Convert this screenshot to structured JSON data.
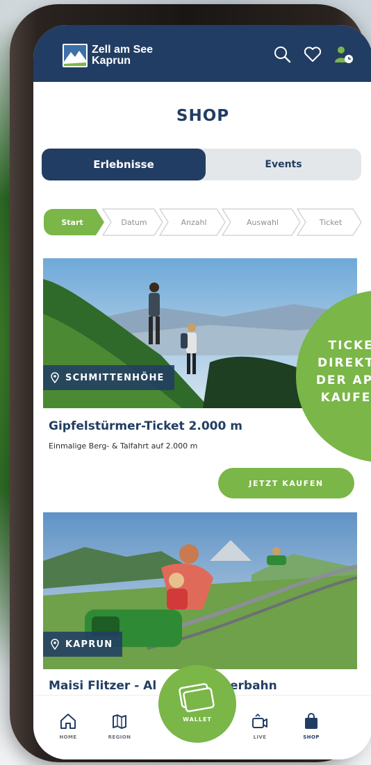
{
  "header": {
    "brand_line1": "Zell am See",
    "brand_line2": "Kaprun"
  },
  "page_title": "SHOP",
  "segments": {
    "left": "Erlebnisse",
    "right": "Events"
  },
  "steps": [
    "Start",
    "Datum",
    "Anzahl",
    "Auswahl",
    "Ticket"
  ],
  "cards": [
    {
      "location": "SCHMITTENHÖHE",
      "title": "Gipfelstürmer-Ticket 2.000 m",
      "subtitle": "Einmalige Berg- & Talfahrt auf 2.000 m",
      "button": "JETZT KAUFEN"
    },
    {
      "location": "KAPRUN",
      "title_left": "Maisi Flitzer - Al",
      "title_right": "erbahn"
    }
  ],
  "promo": {
    "line1": "TICKET",
    "line2": "DIREKT",
    "line3": "DER AP",
    "line4": "KAUFE"
  },
  "nav": {
    "home": "HOME",
    "region": "REGION",
    "wallet": "WALLET",
    "live": "LIVE",
    "shop": "SHOP"
  },
  "colors": {
    "navy": "#223d63",
    "green": "#7ab648"
  }
}
